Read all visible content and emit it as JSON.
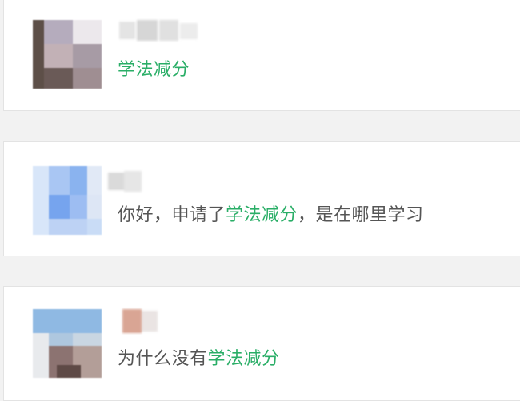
{
  "comments": [
    {
      "message_before": "",
      "keyword": "学法减分",
      "message_after": "",
      "avatar_obscured": true,
      "username_obscured": true
    },
    {
      "message_before": "你好，申请了",
      "keyword": "学法减分",
      "message_after": "，是在哪里学习",
      "avatar_obscured": true,
      "username_obscured": true
    },
    {
      "message_before": "为什么没有",
      "keyword": "学法减分",
      "message_after": "",
      "avatar_obscured": true,
      "username_obscured": true
    }
  ],
  "colors": {
    "keyword": "#2aae67",
    "text": "#555555",
    "card_border": "#e3e3e3",
    "background": "#f2f2f2"
  }
}
